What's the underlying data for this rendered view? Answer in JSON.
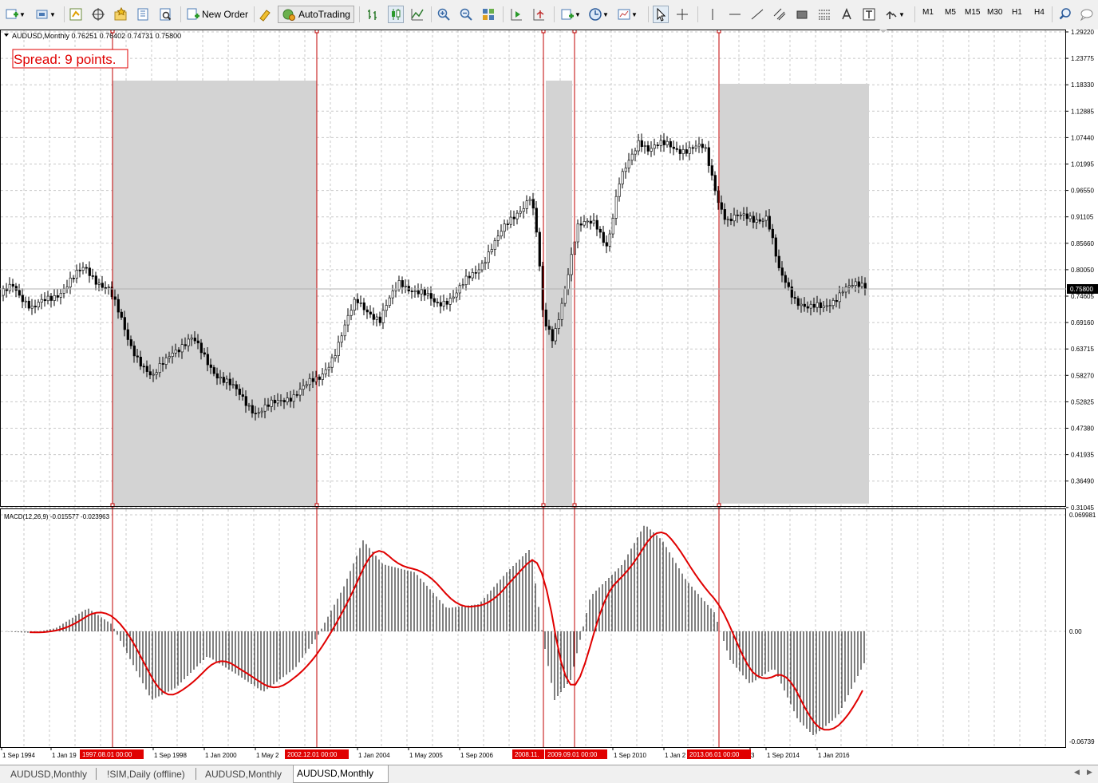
{
  "toolbar": {
    "new_order_label": "New Order",
    "autotrading_label": "AutoTrading",
    "timeframes": [
      "M1",
      "M5",
      "M15",
      "M30",
      "H1",
      "H4"
    ]
  },
  "chart": {
    "symbol_header": "AUDUSD,Monthly",
    "ohlc": "0.76251 0.76402 0.74731 0.75800",
    "spread_label": "Spread: 9 points.",
    "current_price": "0.75800",
    "price_axis": [
      "1.29220",
      "1.23775",
      "1.18330",
      "1.12885",
      "1.07440",
      "1.01995",
      "0.96550",
      "0.91105",
      "0.85660",
      "0.80050",
      "0.74605",
      "0.69160",
      "0.63715",
      "0.58270",
      "0.52825",
      "0.47380",
      "0.41935",
      "0.36490",
      "0.31045"
    ],
    "indicator_label": "MACD(12,26,9) -0.015577 -0.023963",
    "macd_axis": [
      "0.069981",
      "0.00",
      "-0.06739"
    ],
    "time_axis": [
      "1 Sep 1994",
      "1 Jan 19",
      "1 Sep 1998",
      "1 Jan 2000",
      "1 May 2",
      "1 Jan 2004",
      "1 May 2005",
      "1 Sep 2006",
      "1 Sep 2010",
      "1 Jan 2",
      "3",
      "1 Sep 2014",
      "1 Jan 2016"
    ],
    "time_markers": [
      "1997.08.01 00:00",
      "2002.12.01 00:00",
      "2008.11.",
      "2009.09.01 00:00",
      "2013.06.01 00:00"
    ],
    "colors": {
      "shade": "#d3d3d3",
      "signal": "#e00000",
      "marker": "#c00000",
      "candle": "#000000",
      "grid": "#c0c0c0"
    }
  },
  "tabs": [
    "AUDUSD,Monthly",
    "!SIM,Daily (offline)",
    "AUDUSD,Monthly",
    "AUDUSD,Monthly"
  ]
}
